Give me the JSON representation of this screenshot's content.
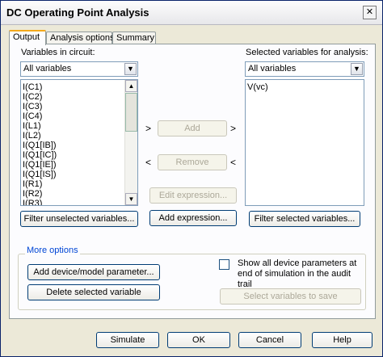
{
  "window": {
    "title": "DC Operating Point Analysis",
    "close_glyph": "✕"
  },
  "tabs": [
    {
      "label": "Output",
      "active": true
    },
    {
      "label": "Analysis options",
      "active": false
    },
    {
      "label": "Summary",
      "active": false
    }
  ],
  "left": {
    "label": "Variables in circuit:",
    "filter_value": "All variables",
    "items": [
      "I(C1)",
      "I(C2)",
      "I(C3)",
      "I(C4)",
      "I(L1)",
      "I(L2)",
      "I(Q1[IB])",
      "I(Q1[IC])",
      "I(Q1[IE])",
      "I(Q1[IS])",
      "I(R1)",
      "I(R2)",
      "I(R3)"
    ],
    "filter_button": "Filter unselected variables..."
  },
  "middle": {
    "add_label": "Add",
    "remove_label": "Remove",
    "edit_expression_label": "Edit expression...",
    "add_expression_label": "Add expression...",
    "arrow_right": ">",
    "arrow_left": "<"
  },
  "right": {
    "label": "Selected variables for analysis:",
    "filter_value": "All variables",
    "items": [
      "V(vc)"
    ],
    "filter_button": "Filter selected variables..."
  },
  "more_options": {
    "title": "More options",
    "add_device_param": "Add device/model parameter...",
    "delete_selected": "Delete selected variable",
    "show_all_params_text": "Show all device parameters at end of simulation in the audit trail",
    "show_all_params_checked": false,
    "select_vars_label": "Select variables to save"
  },
  "footer": {
    "simulate": "Simulate",
    "ok": "OK",
    "cancel": "Cancel",
    "help": "Help"
  },
  "icons": {
    "dropdown": "▼",
    "scroll_up": "▲",
    "scroll_down": "▼"
  }
}
